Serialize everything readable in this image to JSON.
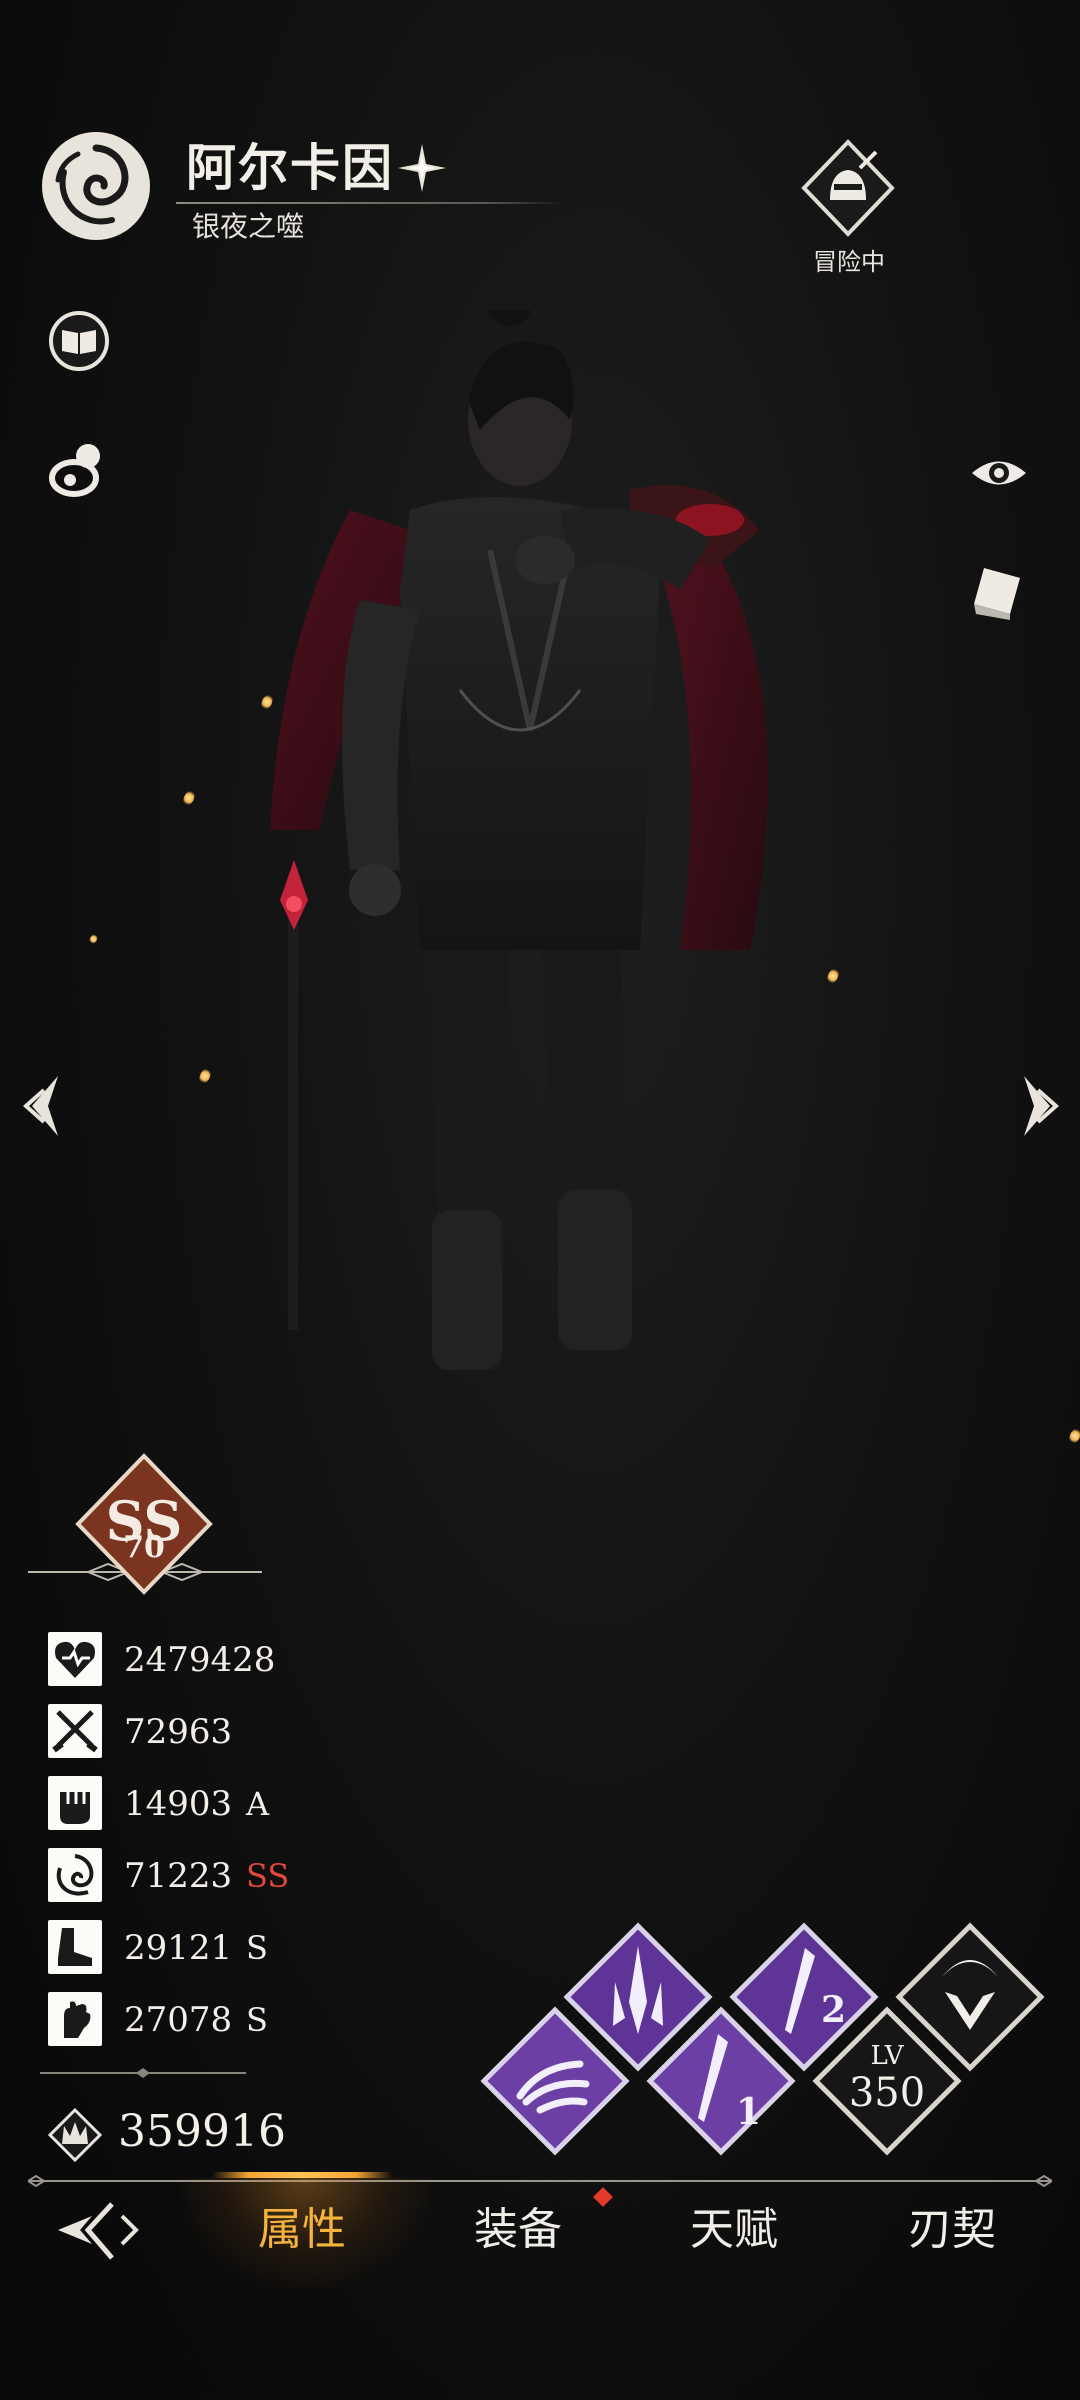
{
  "header": {
    "name": "阿尔卡因",
    "title": "银夜之噬",
    "status": "冒险中"
  },
  "rank": {
    "grade": "SS",
    "level": "70"
  },
  "stats": [
    {
      "icon": "heart-icon",
      "value": "2479428",
      "grade": ""
    },
    {
      "icon": "crossed-swords-icon",
      "value": "72963",
      "grade": ""
    },
    {
      "icon": "fist-icon",
      "value": "14903",
      "grade": "A"
    },
    {
      "icon": "swirl-icon",
      "value": "71223",
      "grade": "SS"
    },
    {
      "icon": "boot-icon",
      "value": "29121",
      "grade": "S"
    },
    {
      "icon": "hand-icon",
      "value": "27078",
      "grade": "S"
    }
  ],
  "power": "359916",
  "skills": {
    "slot1_number": "1",
    "slot2_number": "2",
    "lv_label": "LV",
    "lv_value": "350"
  },
  "tabs": {
    "attributes": "属性",
    "equipment": "装备",
    "talent": "天赋",
    "blade": "刃契"
  },
  "colors": {
    "accent": "#f5b33e",
    "grade_ss": "#e0483b",
    "skill_purple": "#6b3fa3",
    "rank_brown": "#7a3420"
  }
}
